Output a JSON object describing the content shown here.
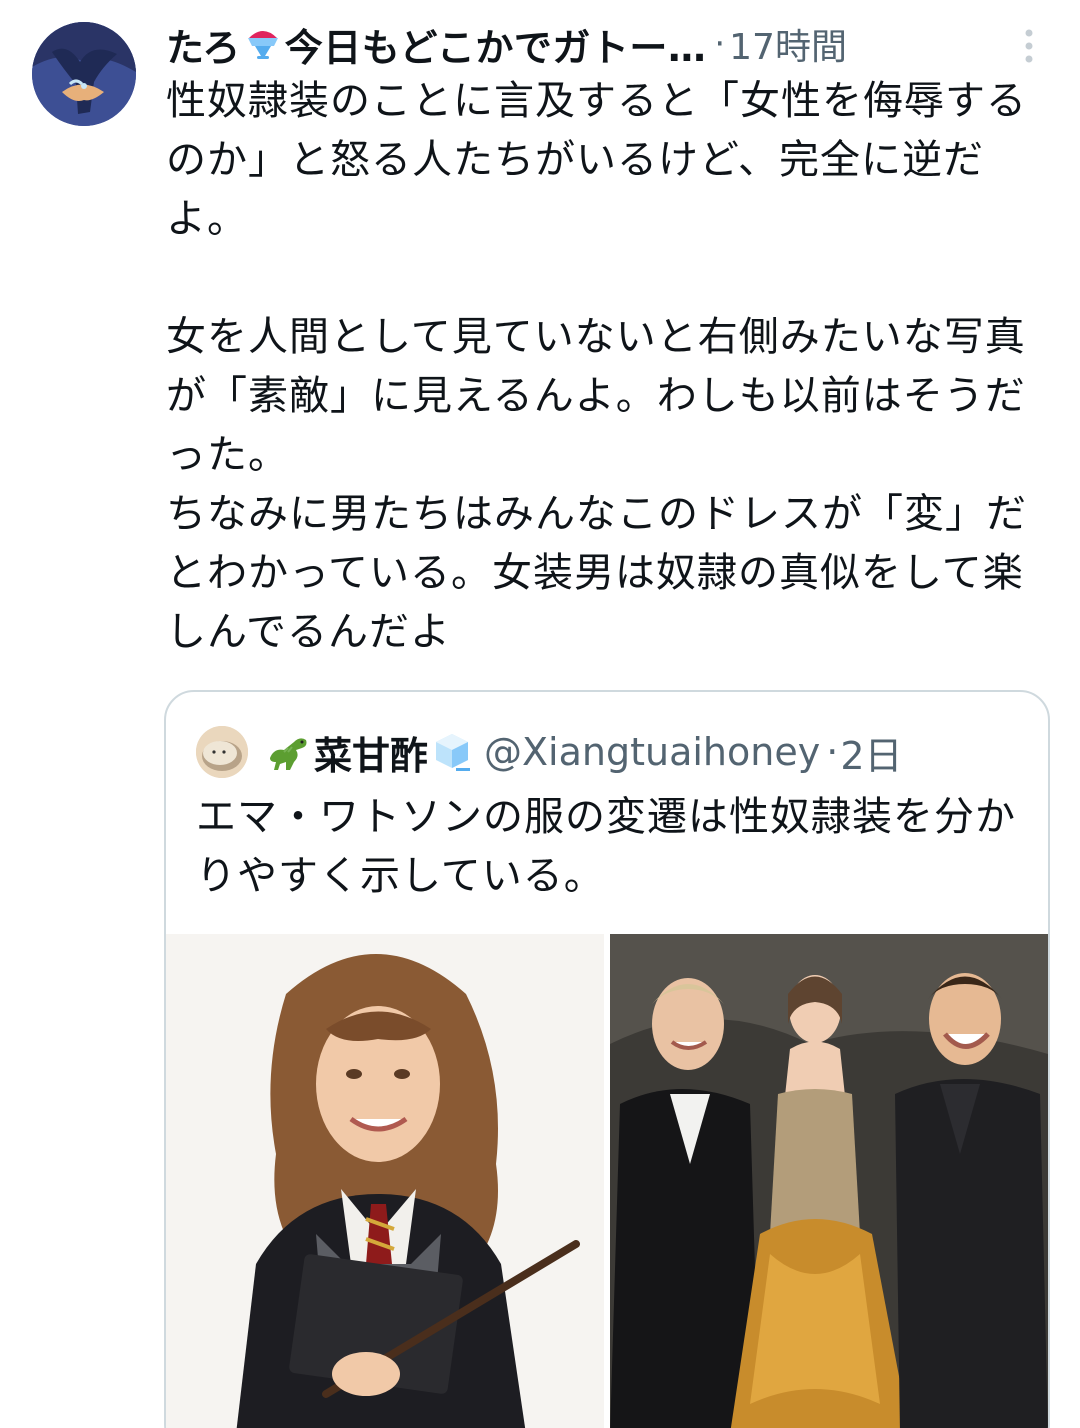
{
  "tweet": {
    "author": {
      "name_prefix": "たろ",
      "name_suffix": "今日もどこかでガトー…",
      "avatar_icon": "monster-avatar-icon",
      "name_emoji_icon": "shaved-ice-icon"
    },
    "separator": "·",
    "time": "17時間",
    "more_icon": "more-vertical-icon",
    "body": "性奴隷装のことに言及すると「女性を侮辱するのか」と怒る人たちがいるけど、完全に逆だよ。\n\n女を人間として見ていないと右側みたいな写真が「素敵」に見えるんよ。わしも以前はそうだった。\nちなみに男たちはみんなこのドレスが「変」だとわかっている。女装男は奴隷の真似をして楽しんでるんだよ"
  },
  "quote": {
    "author": {
      "name": "菜甘酢",
      "handle": "@Xiangtuaihoney",
      "avatar_icon": "round-creature-avatar-icon",
      "name_prefix_emoji_icon": "dinosaur-icon",
      "name_suffix_emoji_icon": "ice-cube-icon"
    },
    "separator": "·",
    "time": "2日",
    "body": "エマ・ワトソンの服の変遷は性奴隷装を分かりやすく示している。",
    "media": [
      {
        "name": "photo-girl-in-school-uniform"
      },
      {
        "name": "photo-three-people-at-premiere"
      }
    ]
  },
  "colors": {
    "text": "#0f1419",
    "secondary": "#536471",
    "border": "#cfd9de"
  }
}
